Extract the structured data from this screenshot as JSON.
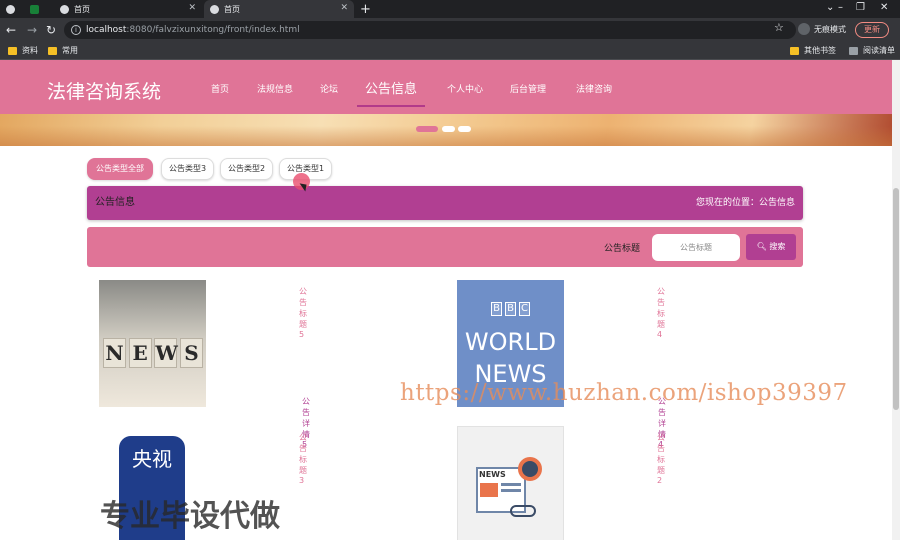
{
  "browser": {
    "tabs": [
      {
        "label": ""
      },
      {
        "label": ""
      },
      {
        "label": "首页"
      },
      {
        "label": "首页"
      }
    ],
    "url_host": "localhost",
    "url_path": ":8080/falvzixunxitong/front/index.html",
    "incognito_label": "无痕模式",
    "update_label": "更新",
    "bookmarks": [
      "资料",
      "常用"
    ],
    "bookmarks_right": [
      "其他书签",
      "阅读清单"
    ]
  },
  "site": {
    "brand": "法律咨询系统",
    "menu": [
      {
        "label": "首页",
        "active": false
      },
      {
        "label": "法规信息",
        "active": false
      },
      {
        "label": "论坛",
        "active": false
      },
      {
        "label": "公告信息",
        "active": true
      },
      {
        "label": "个人中心",
        "active": false
      },
      {
        "label": "后台管理",
        "active": false
      },
      {
        "label": "法律咨询",
        "active": false
      }
    ],
    "filters": [
      {
        "label": "公告类型全部",
        "active": true
      },
      {
        "label": "公告类型3",
        "active": false
      },
      {
        "label": "公告类型2",
        "active": false
      },
      {
        "label": "公告类型1",
        "active": false
      }
    ],
    "breadcrumb_title": "公告信息",
    "breadcrumb_here": "您现在的位置：公告信息",
    "search": {
      "label": "公告标题",
      "placeholder": "公告标题",
      "button": "搜索"
    },
    "cards": [
      {
        "title": "公告标题5",
        "detail": "公告详情5"
      },
      {
        "title": "公告标题4",
        "detail": "公告详情4"
      },
      {
        "title": "公告标题3",
        "detail": ""
      },
      {
        "title": "公告标题2",
        "detail": ""
      }
    ],
    "thumb_text": {
      "news_letters": [
        "N",
        "E",
        "W",
        "S"
      ],
      "bbc_letters": [
        "B",
        "B",
        "C"
      ],
      "bbc_world": "WORLD",
      "bbc_news": "NEWS",
      "cctv": "央视",
      "paper_label": "NEWS"
    }
  },
  "overlays": {
    "watermark_url": "https://www.huzhan.com/ishop39397",
    "watermark_cn": "专业毕设代做"
  },
  "colors": {
    "primary_pink": "#e07497",
    "accent_purple": "#b13f92"
  }
}
